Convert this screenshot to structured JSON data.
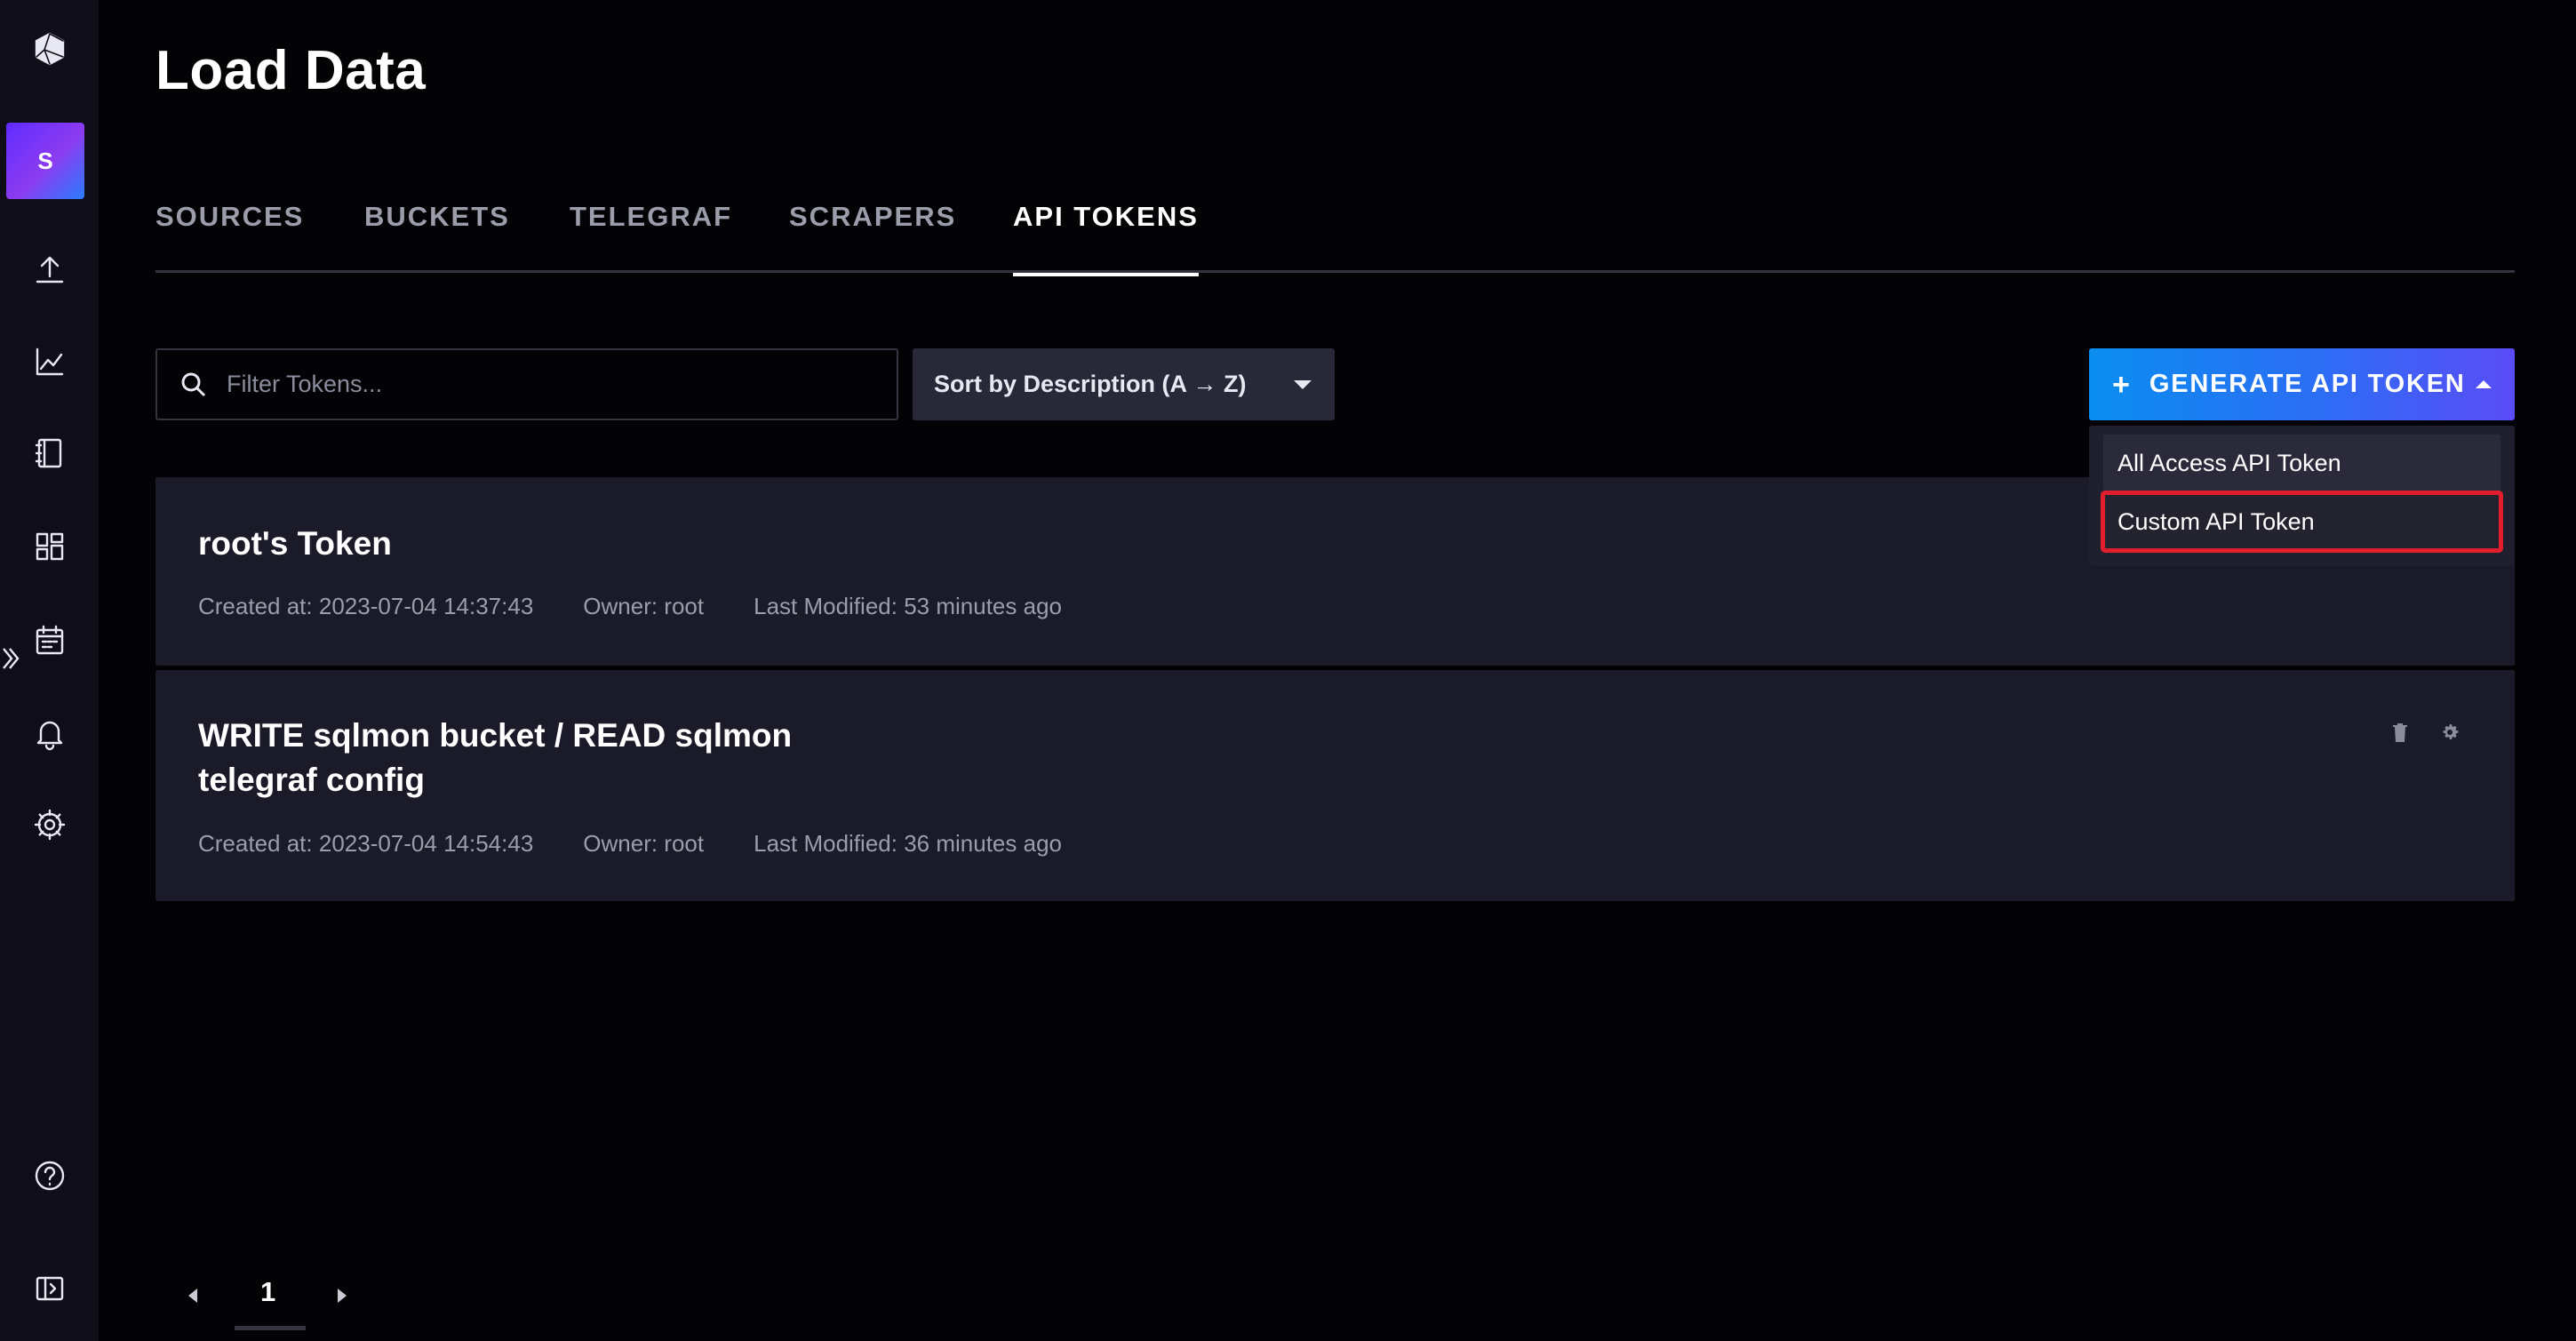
{
  "page": {
    "title": "Load Data"
  },
  "sidebar": {
    "org_initial": "S",
    "items": [
      {
        "name": "logo-icon"
      },
      {
        "name": "org-avatar"
      },
      {
        "name": "upload-icon"
      },
      {
        "name": "chart-icon"
      },
      {
        "name": "notebook-icon"
      },
      {
        "name": "dashboard-icon"
      },
      {
        "name": "calendar-icon"
      },
      {
        "name": "bell-icon"
      },
      {
        "name": "gear-icon"
      },
      {
        "name": "help-icon"
      },
      {
        "name": "collapse-panel-icon"
      }
    ]
  },
  "tabs": [
    {
      "label": "SOURCES",
      "active": false
    },
    {
      "label": "BUCKETS",
      "active": false
    },
    {
      "label": "TELEGRAF",
      "active": false
    },
    {
      "label": "SCRAPERS",
      "active": false
    },
    {
      "label": "API TOKENS",
      "active": true
    }
  ],
  "toolbar": {
    "search_placeholder": "Filter Tokens...",
    "sort_label": "Sort by Description (A → Z)",
    "generate_label": "GENERATE API TOKEN",
    "generate_plus": "+"
  },
  "generate_menu": {
    "items": [
      {
        "label": "All Access API Token",
        "highlighted": false
      },
      {
        "label": "Custom API Token",
        "highlighted": true
      }
    ]
  },
  "tokens": [
    {
      "title": "root's Token",
      "created": "Created at: 2023-07-04 14:37:43",
      "owner": "Owner: root",
      "modified": "Last Modified: 53 minutes ago"
    },
    {
      "title_line1": "WRITE sqlmon bucket / READ sqlmon",
      "title_line2": "telegraf config",
      "created": "Created at: 2023-07-04 14:54:43",
      "owner": "Owner: root",
      "modified": "Last Modified: 36 minutes ago"
    }
  ],
  "pagination": {
    "current_page": "1"
  },
  "colors": {
    "background": "#030306",
    "sidebar": "#0f0e18",
    "card": "#1a1a28",
    "accent_blue": "#0a8ef0",
    "accent_purple": "#5b4cf7",
    "highlight_red": "#e01e2e"
  }
}
